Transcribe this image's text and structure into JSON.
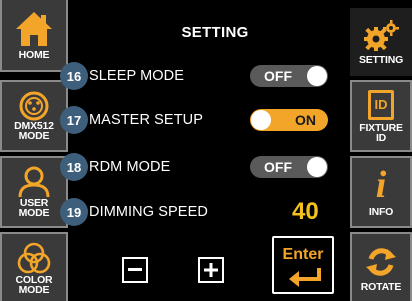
{
  "title": "SETTING",
  "left_nav": [
    {
      "id": "home",
      "label": "HOME",
      "icon": "home-icon"
    },
    {
      "id": "dmx",
      "label_line1": "DMX512",
      "label_line2": "MODE",
      "icon": "dmx-connector-icon"
    },
    {
      "id": "user",
      "label_line1": "USER",
      "label_line2": "MODE",
      "icon": "user-icon"
    },
    {
      "id": "color",
      "label_line1": "COLOR",
      "label_line2": "MODE",
      "icon": "color-circles-icon"
    }
  ],
  "right_nav": [
    {
      "id": "setting",
      "label": "SETTING",
      "icon": "gear-icon",
      "active": true
    },
    {
      "id": "fixture",
      "label_line1": "FIXTURE",
      "label_line2": "ID",
      "icon": "id-card-icon",
      "icon_text": "ID"
    },
    {
      "id": "info",
      "label": "INFO",
      "icon": "info-icon"
    },
    {
      "id": "rotate",
      "label": "ROTATE",
      "icon": "rotate-icon"
    }
  ],
  "menu": [
    {
      "num": "16",
      "label": "SLEEP MODE",
      "state": "OFF"
    },
    {
      "num": "17",
      "label": "MASTER SETUP",
      "state": "ON"
    },
    {
      "num": "18",
      "label": "RDM MODE",
      "state": "OFF"
    },
    {
      "num": "19",
      "label": "DIMMING SPEED",
      "value": "40"
    }
  ],
  "controls": {
    "minus": "−",
    "plus": "+",
    "enter": "Enter"
  },
  "colors": {
    "accent": "#f3a52a",
    "value": "#f4c21c",
    "badge": "#3e5f7c",
    "toggle_off": "#5a5a5a"
  }
}
